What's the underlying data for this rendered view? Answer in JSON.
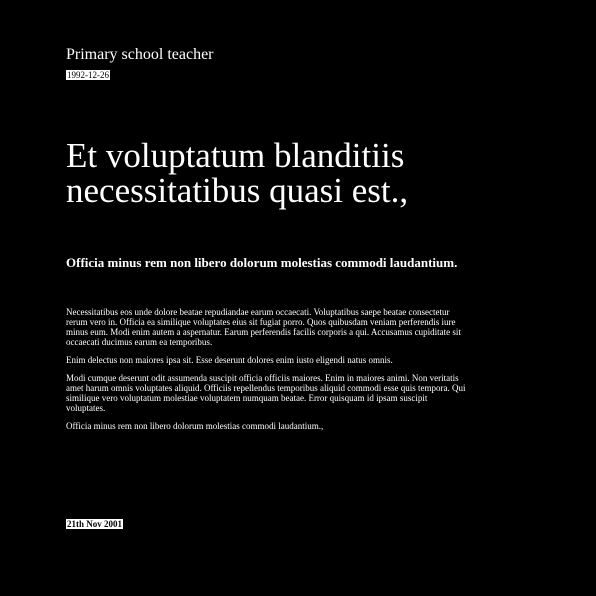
{
  "document": {
    "author_role": "Primary school teacher",
    "date_top": "1992-12-26",
    "title": "Et voluptatum blanditiis necessitatibus quasi est.,",
    "subtitle": "Officia minus rem non libero dolorum molestias commodi laudantium.",
    "paragraphs": [
      "Necessitatibus eos unde dolore beatae repudiandae earum occaecati. Voluptatibus saepe beatae consectetur rerum vero in. Officia ea similique voluptates eius sit fugiat porro. Quos quibusdam veniam perferendis iure minus eum. Modi enim autem a aspernatur. Earum perferendis facilis corporis a qui. Accusamus cupiditate sit occaecati ducimus earum ea temporibus.",
      "Enim delectus non maiores ipsa sit. Esse deserunt dolores enim iusto eligendi natus omnis.",
      "Modi cumque deserunt odit assumenda suscipit officia officiis maiores. Enim in maiores animi. Non veritatis amet harum omnis voluptates aliquid. Officiis repellendus temporibus aliquid commodi esse quis tempora. Qui similique vero voluptatum molestiae voluptatem numquam beatae. Error quisquam id ipsam suscipit voluptates.",
      "Officia minus rem non libero dolorum molestias commodi laudantium.,"
    ],
    "date_bottom": "21th Nov 2001"
  },
  "colors": {
    "background": "#000000",
    "text": "#ffffff"
  }
}
